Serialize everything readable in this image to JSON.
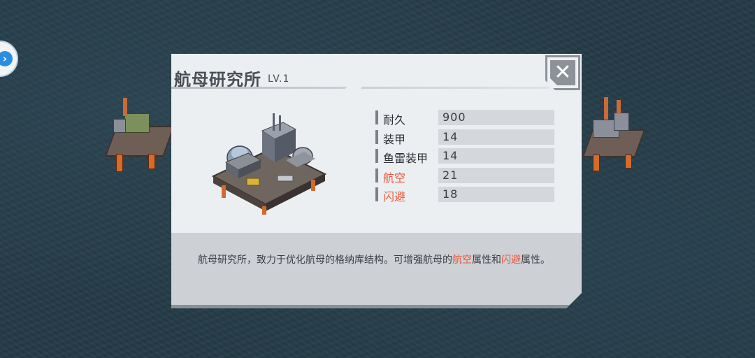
{
  "dialog": {
    "title": "航母研究所",
    "level": "LV.1"
  },
  "stats": [
    {
      "label": "耐久",
      "value": "900",
      "highlight": false
    },
    {
      "label": "装甲",
      "value": "14",
      "highlight": false
    },
    {
      "label": "鱼雷装甲",
      "value": "14",
      "highlight": false
    },
    {
      "label": "航空",
      "value": "21",
      "highlight": true
    },
    {
      "label": "闪避",
      "value": "18",
      "highlight": true
    }
  ],
  "description": {
    "part1": "航母研究所，致力于优化航母的格纳库结构。可增强航母的",
    "hl1": "航空",
    "part2": "属性和",
    "hl2": "闪避",
    "part3": "属性。"
  },
  "icons": {
    "close": "close-icon",
    "side": "chevron-right-icon"
  },
  "colors": {
    "highlight": "#ea5a3a",
    "panel": "#eceff2",
    "side_button": "#2a8fe0"
  }
}
